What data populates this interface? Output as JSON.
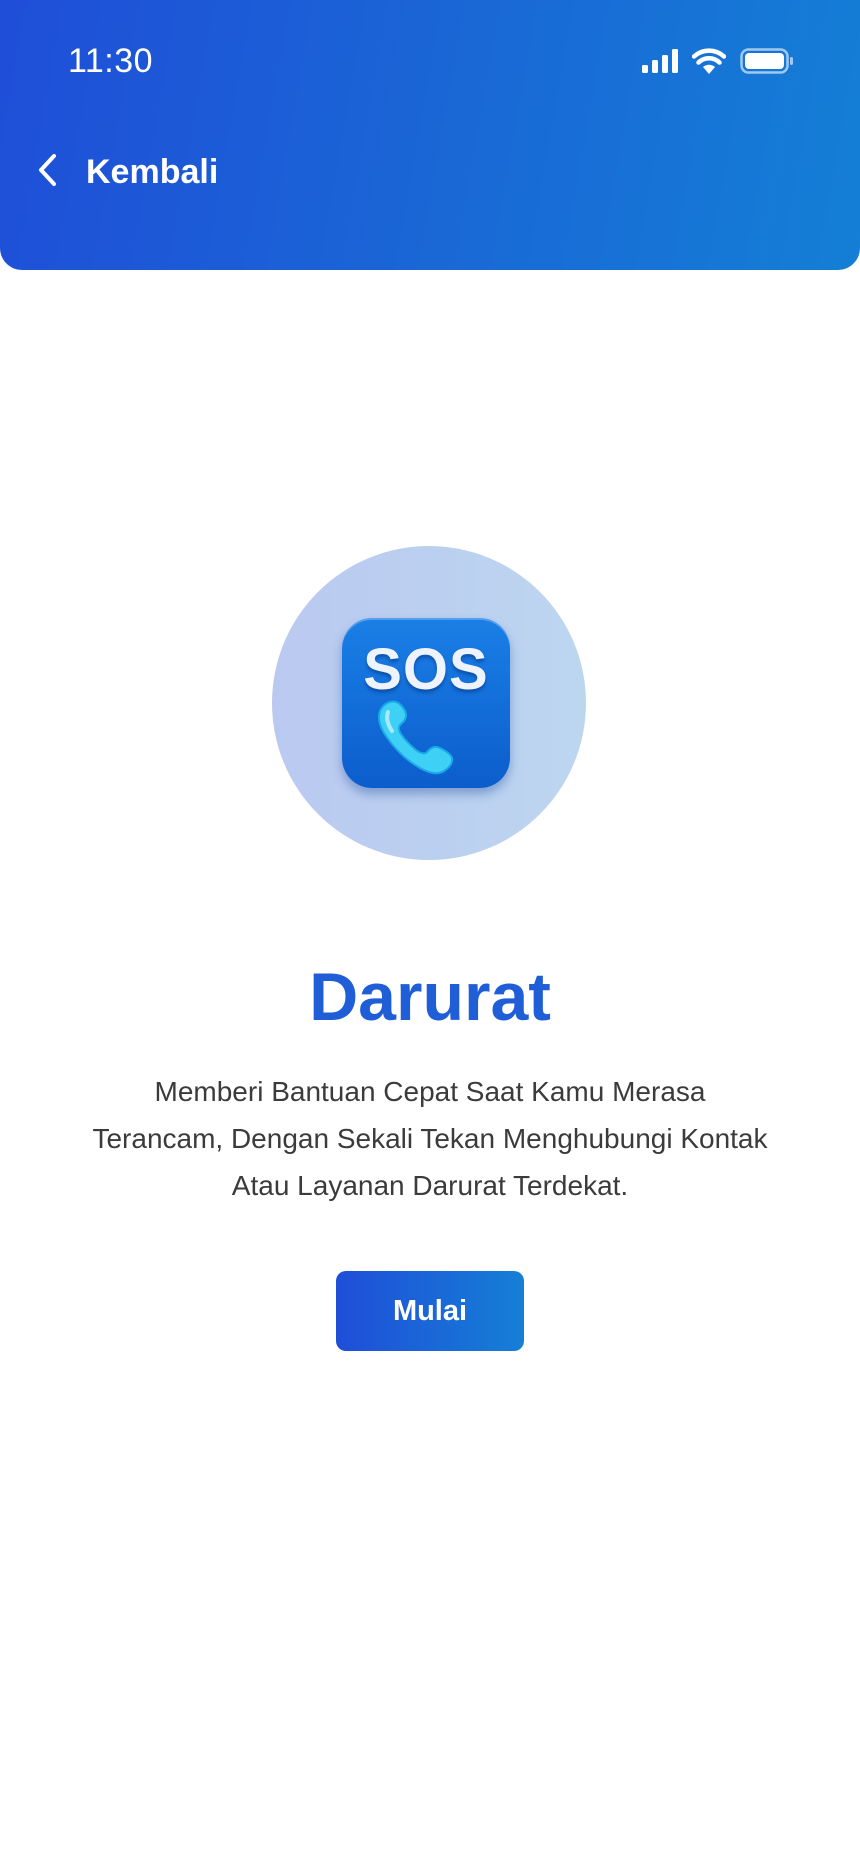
{
  "status_bar": {
    "time": "11:30",
    "icons": [
      "signal-icon",
      "wifi-icon",
      "battery-icon"
    ]
  },
  "header": {
    "back_label": "Kembali",
    "back_icon": "chevron-left-icon"
  },
  "hero": {
    "icon_text": "SOS",
    "icon": "phone-icon"
  },
  "content": {
    "title": "Darurat",
    "description": "Memberi Bantuan Cepat Saat Kamu Merasa Terancam, Dengan Sekali Tekan Menghubungi Kontak Atau Layanan Darurat Terdekat."
  },
  "actions": {
    "start_label": "Mulai"
  },
  "colors": {
    "header_gradient_start": "#1f4ed8",
    "header_gradient_end": "#147fd6",
    "title": "#1f5ed6",
    "body_text": "#3b3b3b",
    "hero_circle": "#bccfef",
    "button_start": "#1f4ed8",
    "button_end": "#157fd6"
  }
}
